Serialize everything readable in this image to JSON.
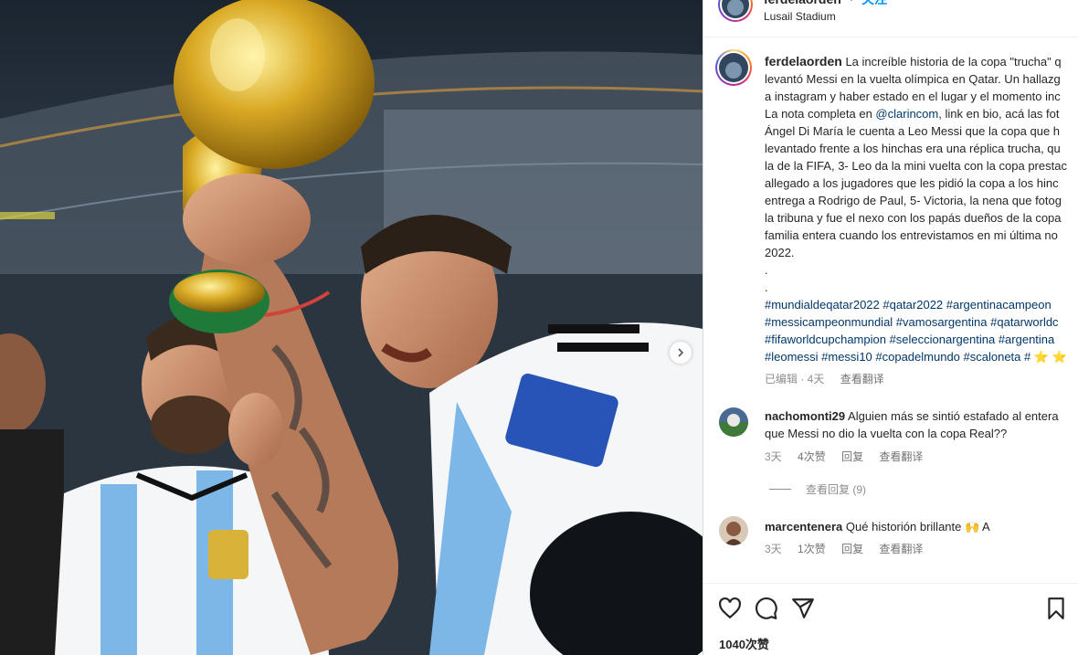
{
  "post": {
    "username": "ferdelaorden",
    "follow_label": "关注",
    "location": "Lusail Stadium"
  },
  "caption": {
    "username": "ferdelaorden",
    "text_1": "La increíble historia de la copa \"trucha\" q\nlevantó Messi en la vuelta olímpica en Qatar. Un hallazg\na instagram y haber estado en el lugar y el momento inc\nLa nota completa en ",
    "mention": "@clarincom",
    "text_2": ", link en bio, acá las fot\nÁngel Di María le cuenta a Leo Messi que la copa que h\nlevantado frente a los hinchas era una réplica trucha, qu\nla de la FIFA, 3- Leo da la mini vuelta con la copa prestac\nallegado a los jugadores que les pidió la copa a los hinc\nentrega a Rodrigo de Paul, 5- Victoria, la nena que fotog\nla tribuna y fue el nexo con los papás dueños de la copa\nfamilia entera cuando los entrevistamos en mi última no\n2022.\n.\n.",
    "hashtags": "#mundialdeqatar2022 #qatar2022 #argentinacampeon\n#messicampeonmundial #vamosargentina #qatarworldc\n#fifaworldcupchampion #seleccionargentina #argentina\n#leomessi #messi10 #copadelmundo #scaloneta # ⭐ ⭐",
    "edited": "已编辑 · 4天",
    "translate": "查看翻译"
  },
  "comments": [
    {
      "username": "nachomonti29",
      "text_line1": "Alguien más se sintió estafado al entera",
      "text_line2": "que Messi no dio la vuelta con la copa Real??",
      "age": "3天",
      "likes": "4次赞",
      "reply": "回复",
      "translate": "查看翻译",
      "view_replies": "查看回复 (9)"
    },
    {
      "username": "marcentenera",
      "text_line1": "Qué historión brillante 🙌 A",
      "age": "3天",
      "likes": "1次赞",
      "reply": "回复",
      "translate": "查看翻译"
    }
  ],
  "footer": {
    "likes_count": "1040次赞"
  },
  "icons": [
    "heart-icon",
    "comment-icon",
    "share-icon",
    "bookmark-icon",
    "chevron-right-icon"
  ],
  "colors": {
    "link": "#00376b",
    "follow": "#0095f6",
    "meta": "#8e8e8e"
  }
}
